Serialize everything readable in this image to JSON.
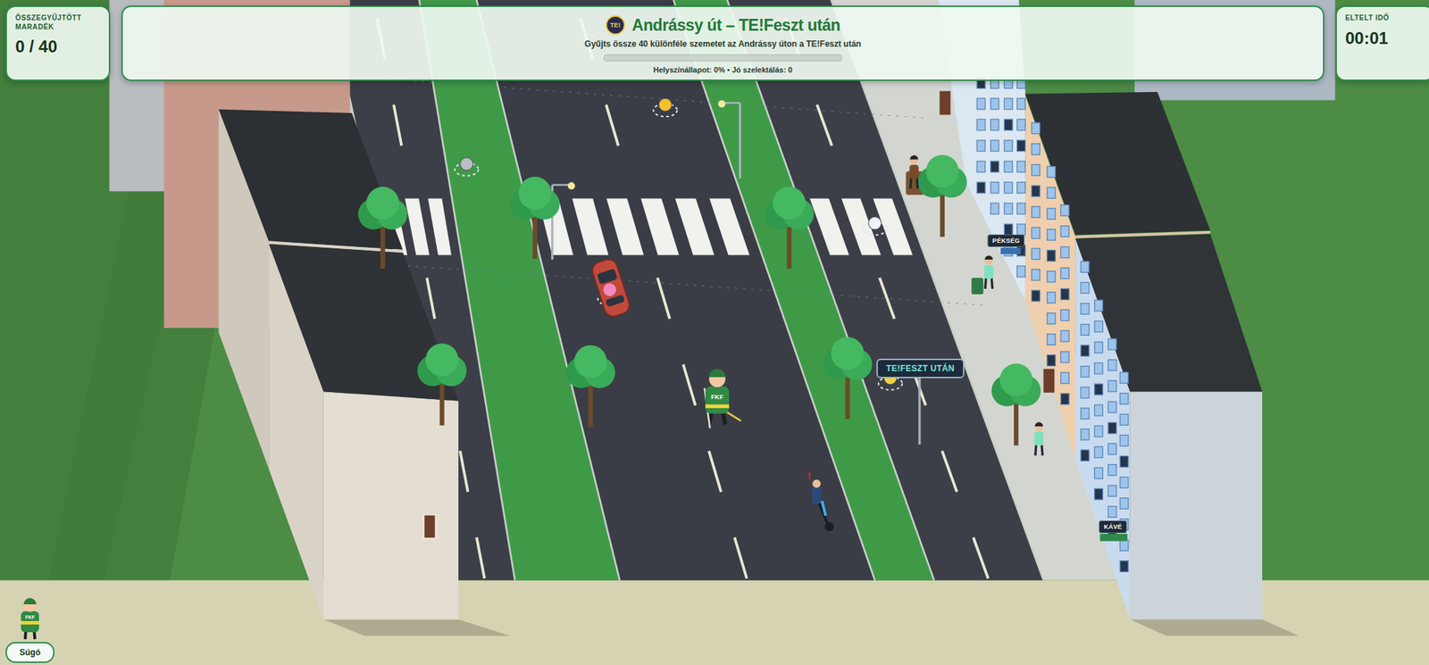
{
  "level": {
    "logo": "TE!",
    "title": "Andrássy út – TE!Feszt után",
    "subtitle": "Gyűjts össze 40 különféle szemetet az Andrássy úton a TE!Feszt után",
    "progress": 0,
    "status": "Helyszínállapot: 0% • Jó szelektálás: 0"
  },
  "collected": {
    "label_lines": [
      "ÖSSZEGYŰJTÖTT",
      "MARADÉK"
    ],
    "value": "0 / 40"
  },
  "timer": {
    "label": "ELTELT IDŐ",
    "value": "00:01"
  },
  "signs": {
    "event": "TE!FESZT UTÁN",
    "bakery": "PÉKSÉG",
    "cafe": "KÁVÉ"
  },
  "player": {
    "badge": "FKF"
  },
  "cyclist": {
    "alert": "!"
  },
  "help_button": {
    "label": "Súgó"
  }
}
